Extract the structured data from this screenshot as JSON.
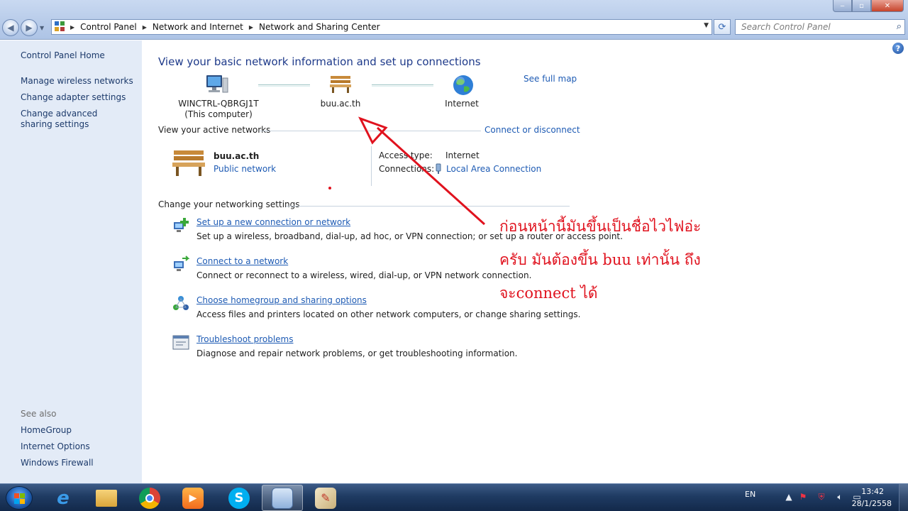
{
  "window": {
    "controls": {
      "minimize": "‒",
      "maximize": "▫",
      "close": "✕"
    }
  },
  "navigation": {
    "back_icon": "back-arrow-icon",
    "forward_icon": "forward-arrow-icon",
    "breadcrumbs": [
      "Control Panel",
      "Network and Internet",
      "Network and Sharing Center"
    ],
    "search_placeholder": "Search Control Panel"
  },
  "sidebar": {
    "home": "Control Panel Home",
    "links": [
      "Manage wireless networks",
      "Change adapter settings",
      "Change advanced sharing settings"
    ],
    "see_also_label": "See also",
    "see_also": [
      "HomeGroup",
      "Internet Options",
      "Windows Firewall"
    ]
  },
  "main": {
    "title": "View your basic network information and set up connections",
    "map": {
      "computer_name": "WINCTRL-QBRGJ1T",
      "computer_note": "(This computer)",
      "network_name": "buu.ac.th",
      "internet_label": "Internet",
      "see_full_map": "See full map"
    },
    "active_networks": {
      "title": "View your active networks",
      "connect_link": "Connect or disconnect",
      "network_name": "buu.ac.th",
      "network_type": "Public network",
      "access_type_label": "Access type:",
      "access_type_value": "Internet",
      "connections_label": "Connections:",
      "connections_value": "Local Area Connection"
    },
    "settings": {
      "title": "Change your networking settings",
      "tasks": [
        {
          "link": "Set up a new connection or network",
          "desc": "Set up a wireless, broadband, dial-up, ad hoc, or VPN connection; or set up a router or access point."
        },
        {
          "link": "Connect to a network",
          "desc": "Connect or reconnect to a wireless, wired, dial-up, or VPN network connection."
        },
        {
          "link": "Choose homegroup and sharing options",
          "desc": "Access files and printers located on other network computers, or change sharing settings."
        },
        {
          "link": "Troubleshoot problems",
          "desc": "Diagnose and repair network problems, or get troubleshooting information."
        }
      ]
    }
  },
  "annotation": {
    "lines": [
      "ก่อนหน้านี้มันขึ้นเป็นชื่อไวไฟอ่ะ",
      "ครับ มันต้องขึ้น buu เท่านั้น ถึง",
      "จะconnect ได้"
    ],
    "color": "#e0121e"
  },
  "taskbar": {
    "apps": [
      "internet-explorer-icon",
      "file-explorer-icon",
      "chrome-icon",
      "media-player-icon",
      "skype-icon",
      "control-panel-icon",
      "paint-icon"
    ],
    "language": "EN",
    "time": "13:42",
    "date": "28/1/2558"
  }
}
